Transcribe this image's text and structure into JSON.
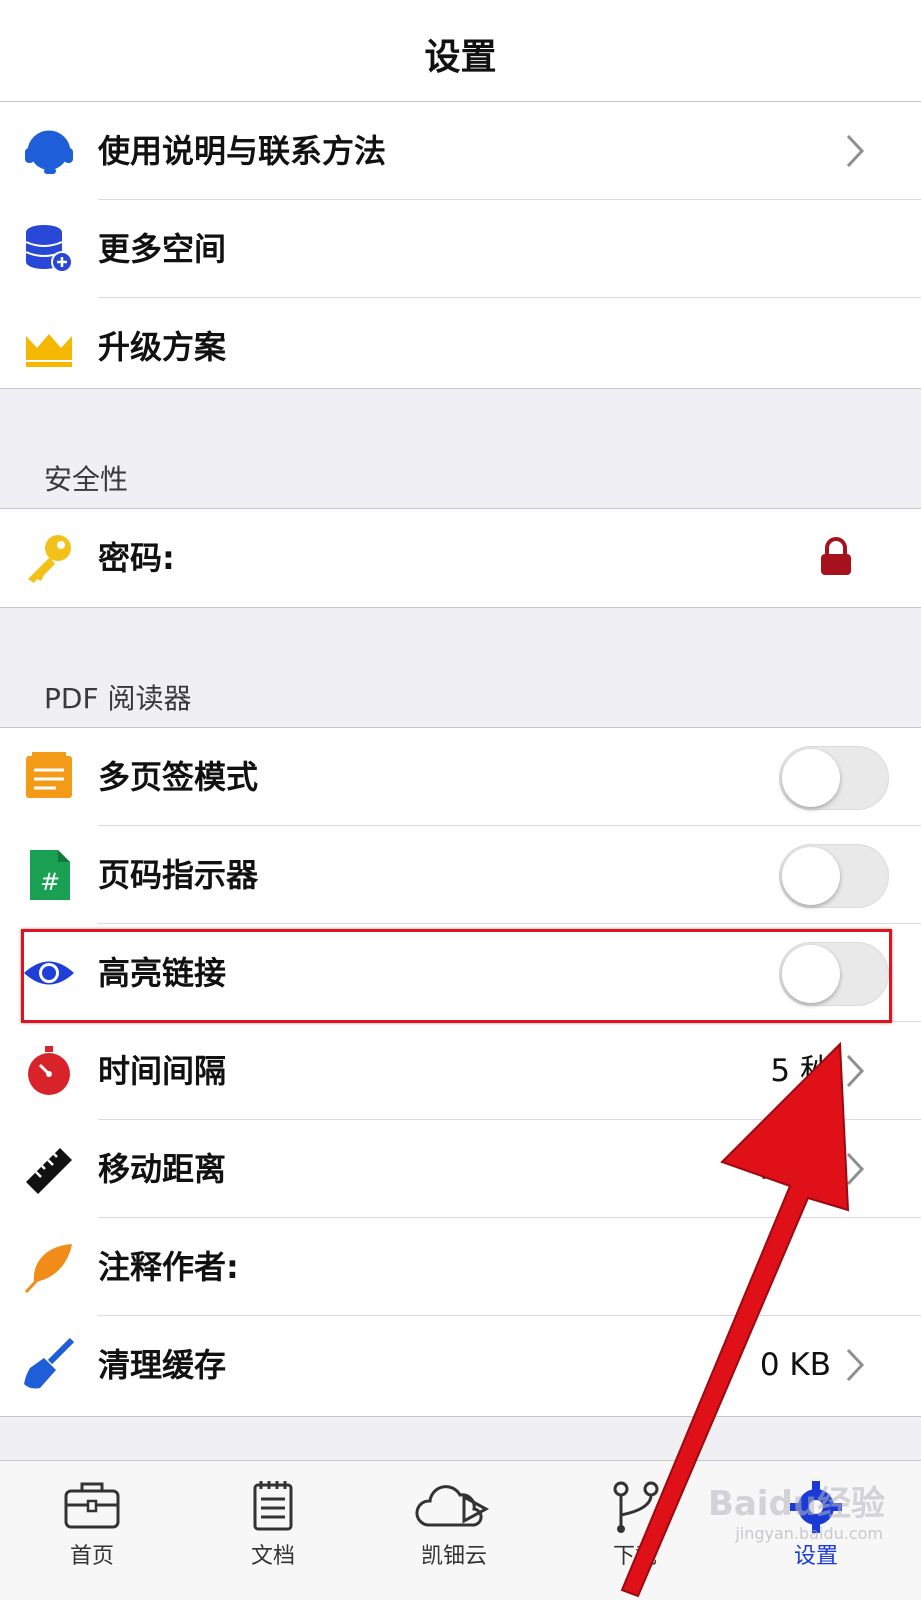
{
  "navbar": {
    "title": "设置"
  },
  "group1": {
    "items": [
      {
        "label": "使用说明与联系方法",
        "icon": "headset-icon"
      },
      {
        "label": "更多空间",
        "icon": "database-add-icon"
      },
      {
        "label": "升级方案",
        "icon": "crown-icon"
      }
    ]
  },
  "security": {
    "header": "安全性",
    "items": [
      {
        "label": "密码:",
        "icon": "key-icon",
        "accessory": "lock-icon"
      }
    ]
  },
  "pdf": {
    "header": "PDF 阅读器",
    "items": [
      {
        "label": "多页签模式",
        "icon": "tabs-icon",
        "toggle": false
      },
      {
        "label": "页码指示器",
        "icon": "page-number-icon",
        "toggle": false
      },
      {
        "label": "高亮链接",
        "icon": "eye-icon",
        "toggle": false
      },
      {
        "label": "时间间隔",
        "icon": "stopwatch-icon",
        "value": "5 秒"
      },
      {
        "label": "移动距离",
        "icon": "ruler-icon",
        "value": "40 点"
      },
      {
        "label": "注释作者:",
        "icon": "feather-icon",
        "value": ""
      },
      {
        "label": "清理缓存",
        "icon": "broom-icon",
        "value": "0 KB"
      }
    ]
  },
  "tabbar": {
    "tabs": [
      {
        "label": "首页",
        "icon": "briefcase-icon",
        "active": false
      },
      {
        "label": "文档",
        "icon": "notepad-icon",
        "active": false
      },
      {
        "label": "凯钿云",
        "icon": "cloud-icon",
        "active": false
      },
      {
        "label": "下载",
        "icon": "download-branch-icon",
        "active": false
      },
      {
        "label": "设置",
        "icon": "gear-icon",
        "active": true
      }
    ]
  },
  "colors": {
    "accent": "#1a3ad6",
    "annotation": "#e0121b"
  },
  "watermark": {
    "text": "Baidu经验",
    "sub": "jingyan.baidu.com"
  }
}
